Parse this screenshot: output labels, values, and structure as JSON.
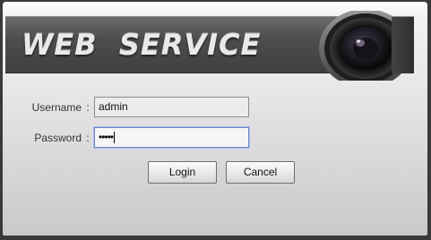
{
  "banner": {
    "title": "WEB  SERVICE"
  },
  "login_form": {
    "username_label": "Username",
    "username_value": "admin",
    "password_label": "Password",
    "password_mask": "•••••",
    "colon": ":"
  },
  "buttons": {
    "login_label": "Login",
    "cancel_label": "Cancel"
  }
}
